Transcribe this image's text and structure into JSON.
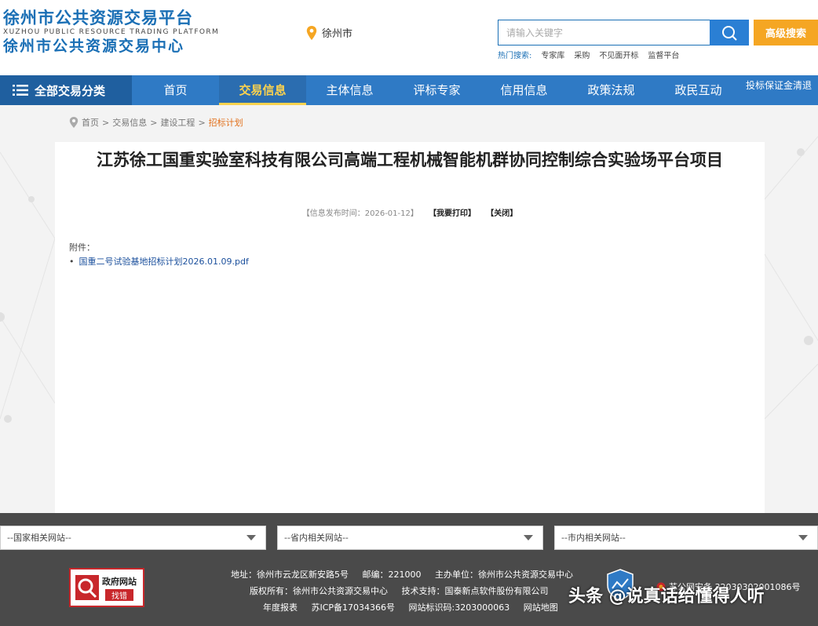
{
  "header": {
    "logo_cn": "徐州市公共资源交易平台",
    "logo_en": "XUZHOU PUBLIC RESOURCE TRADING PLATFORM",
    "logo_cn2": "徐州市公共资源交易中心",
    "city": "徐州市",
    "search_placeholder": "请输入关键字",
    "advanced_search": "高级搜索",
    "hot_label": "热门搜索:",
    "hot_items": [
      "专家库",
      "采购",
      "不见面开标",
      "监督平台"
    ]
  },
  "nav": {
    "category": "全部交易分类",
    "items": [
      "首页",
      "交易信息",
      "主体信息",
      "评标专家",
      "信用信息",
      "政策法规",
      "政民互动"
    ],
    "extra": "投标保证金清退"
  },
  "breadcrumb": [
    "首页",
    "交易信息",
    "建设工程",
    "招标计划"
  ],
  "article": {
    "title": "江苏徐工国重实验室科技有限公司高端工程机械智能机群协同控制综合实验场平台项目",
    "date": "【信息发布时间：2026-01-12】",
    "print": "【我要打印】",
    "close": "【关闭】",
    "attach_label": "附件：",
    "attachments": [
      "国重二号试验基地招标计划2026.01.09.pdf"
    ]
  },
  "links": {
    "national": "--国家相关网站--",
    "provincial": "--省内相关网站--",
    "city": "--市内相关网站--"
  },
  "footer": {
    "gov_title": "政府网站",
    "gov_error": "找错",
    "address": "地址：徐州市云龙区新安路5号",
    "postcode": "邮编：221000",
    "host": "主办单位：徐州市公共资源交易中心",
    "copyright": "版权所有：徐州市公共资源交易中心",
    "tech": "技术支持：国泰新点软件股份有限公司",
    "report": "年度报表",
    "icp": "苏ICP备17034366号",
    "site_id": "网站标识码:3203000063",
    "sitemap": "网站地图",
    "beian": "苏公网安备 32030302001086号"
  },
  "watermark": "头条 @说真话给懂得人听",
  "colors": {
    "brand_blue": "#2f7ac5",
    "nav_dark": "#1f5f9f",
    "accent_yellow": "#fcd24e",
    "orange_button": "#f5a623",
    "breadcrumb_current": "#e2711d",
    "footer_gray": "#4a4a4a"
  }
}
